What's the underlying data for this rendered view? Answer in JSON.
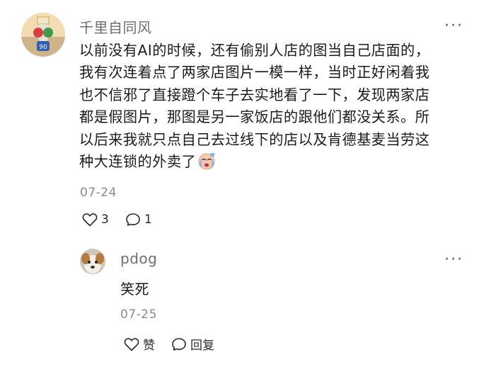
{
  "comment": {
    "username": "千里自同风",
    "more_label": "···",
    "lines": [
      "以前没有AI的时候，还有偷别人店的图当自己店面的，",
      "我有次连着点了两家店图片一模一样，当时正好闲着我",
      "也不信邪了直接蹬个车子去实地看了一下，发现两家店",
      "都是假图片，那图是另一家饭店的跟他们都没关系。所",
      "以后来我就只点自己去过线下的店以及肯德基麦当劳这",
      "种大连锁的外卖了"
    ],
    "emoji_icon": "crying-face-emoji",
    "date": "07-24",
    "likes": "3",
    "comments": "1"
  },
  "reply": {
    "username": "pdog",
    "more_label": "···",
    "text": "笑死",
    "date": "07-25",
    "like_label": "赞",
    "reply_label": "回复"
  },
  "colors": {
    "username": "#6f6f6f",
    "text": "#1b1b1b",
    "meta": "#8a8a8a",
    "icon": "#2a2a2a"
  }
}
